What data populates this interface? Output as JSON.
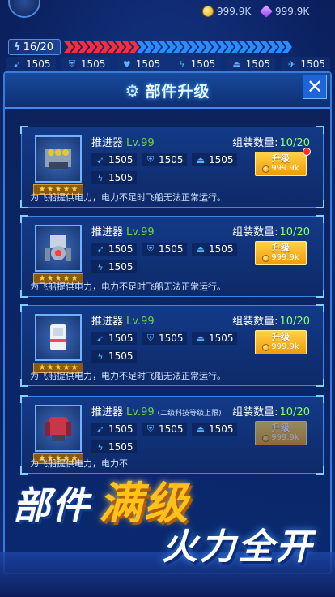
{
  "top_bar": {
    "coins": "999.9K",
    "gems": "999.9K"
  },
  "energy": {
    "label": "16/20",
    "red_segments": 10,
    "blue_segments": 21
  },
  "stats": [
    {
      "icon": "sword-icon",
      "value": "1505"
    },
    {
      "icon": "shield-icon",
      "value": "1505"
    },
    {
      "icon": "heart-icon",
      "value": "1505"
    },
    {
      "icon": "lightning-icon",
      "value": "1505"
    },
    {
      "icon": "turret-icon",
      "value": "1505"
    },
    {
      "icon": "ship-icon",
      "value": "1505"
    }
  ],
  "panel": {
    "title": "部件升级",
    "close_label": "✕"
  },
  "parts": [
    {
      "name": "推进器",
      "level": "Lv.99",
      "note": "",
      "count_label": "组装数量:",
      "count": "10/20",
      "attack": "1505",
      "defense": "1505",
      "hp": "1505",
      "energy": "1505",
      "desc": "为飞船提供电力，电力不足时飞船无法正常运行。",
      "upgrade_label": "升级",
      "upgrade_cost": "999.9k",
      "has_alert": true,
      "upgrade_enabled": true
    },
    {
      "name": "推进器",
      "level": "Lv.99",
      "note": "",
      "count_label": "组装数量:",
      "count": "10/20",
      "attack": "1505",
      "defense": "1505",
      "hp": "1505",
      "energy": "1505",
      "desc": "为飞船提供电力，电力不足时飞船无法正常运行。",
      "upgrade_label": "升级",
      "upgrade_cost": "999.9k",
      "has_alert": false,
      "upgrade_enabled": true
    },
    {
      "name": "推进器",
      "level": "Lv.99",
      "note": "",
      "count_label": "组装数量:",
      "count": "10/20",
      "attack": "1505",
      "defense": "1505",
      "hp": "1505",
      "energy": "1505",
      "desc": "为飞船提供电力，电力不足时飞船无法正常运行。",
      "upgrade_label": "升级",
      "upgrade_cost": "999.9k",
      "has_alert": false,
      "upgrade_enabled": true
    },
    {
      "name": "推进器",
      "level": "Lv.99",
      "note": "(二级科技等级上限)",
      "count_label": "组装数量:",
      "count": "10/20",
      "attack": "1505",
      "defense": "1505",
      "hp": "1505",
      "energy": "1505",
      "desc": "为飞船提供电力，电力不",
      "upgrade_label": "升级",
      "upgrade_cost": "999.9k",
      "has_alert": false,
      "upgrade_enabled": false
    }
  ],
  "banner": {
    "line1_a": "部件",
    "line1_b": "满级",
    "line2": "火力全开"
  },
  "colors": {
    "accent": "#3b86e6",
    "level": "#72d43d",
    "count": "#8bff6a",
    "upgrade": "#f39a07"
  }
}
